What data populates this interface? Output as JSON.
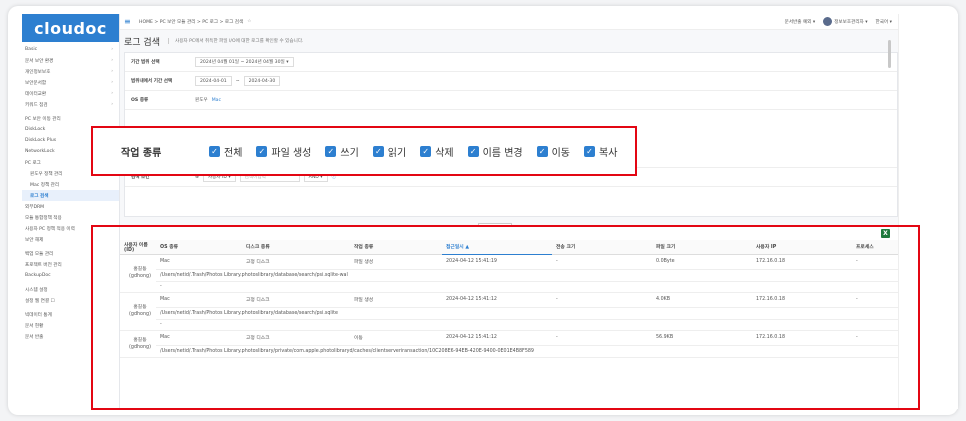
{
  "app": {
    "logo": "cloudoc"
  },
  "sidebar": {
    "items": [
      {
        "label": "Basic",
        "chev": "›"
      },
      {
        "label": "문서 보안 환경",
        "chev": "›"
      },
      {
        "label": "개인정보보호",
        "chev": "›"
      },
      {
        "label": "보안문서함",
        "chev": "›"
      },
      {
        "label": "데이터교환",
        "chev": "›"
      },
      {
        "label": "키워드 점검",
        "chev": "›"
      }
    ],
    "pc_section": "PC 보안 이동 관리",
    "pc_items": [
      "DiskLock",
      "DiskLock Plus",
      "NetworkLock",
      "PC 로그"
    ],
    "pc_log_sub": [
      "윈도우 정책 관리",
      "Mac 정책 관리",
      "로그 검색"
    ],
    "more_items": [
      "외부DRM",
      "모듈 통합정책 적용",
      "사용자 PC 정책 적용 이력",
      "보안 해제"
    ],
    "backup_items": [
      "백업 모듈 관리",
      "프로젝트 버전 관리",
      "BackupDoc"
    ],
    "system_items": [
      "시스템 설정",
      "설정 웹 연결 ☐"
    ],
    "stats_items": [
      "빅데이터 통계",
      "문서 현황",
      "문서 반출"
    ]
  },
  "topbar": {
    "breadcrumb": "HOME > PC 보안 모듈 관리 > PC 로그 > 로그 검색",
    "star": "☆",
    "notify": "문서반출 예외 ▾",
    "user": "정보보호관리자 ▾",
    "lang": "한국어 ▾"
  },
  "page": {
    "title": "로그 검색",
    "description": "사용자 PC에서 취득한 파일 I/O에 대한 로그를 확인할 수 있습니다."
  },
  "form": {
    "period_label": "기간 범위 선택",
    "period_value": "2024년 04월 01일 ~ 2024년 04월 30일 ▾",
    "range_label": "범위내에서 기간 선택",
    "date_from": "2024-04-01",
    "date_to": "2024-04-30",
    "os_label": "OS 종류",
    "os_option1": "윈도우",
    "os_option2": "Mac",
    "cond_label": "검색 조건",
    "cond_plus": "⊕",
    "cond_field": "사용자 ID ▾",
    "cond_placeholder": "검색어입력",
    "cond_op": "AND ▾",
    "cond_info": "ⓘ",
    "search_button": "검색"
  },
  "highlight": {
    "title": "작업 종류",
    "options": [
      "전체",
      "파일 생성",
      "쓰기",
      "읽기",
      "삭제",
      "이름 변경",
      "이동",
      "복사"
    ]
  },
  "table": {
    "excel_icon": "X",
    "columns": [
      "사용자 이름(ID)",
      "OS 종류",
      "디스크 종류",
      "작업 종류",
      "접근일시 ▲",
      "전송 크기",
      "파일 크기",
      "사용자 IP",
      "프로세스"
    ],
    "rows": [
      {
        "user": "홍길동 (gdhong)",
        "os": "Mac",
        "disk": "고정 디스크",
        "action": "파일 생성",
        "date": "2024-04-12 15:41:19",
        "transfer": "-",
        "size": "0.0Byte",
        "ip": "172.16.0.18",
        "process": "-",
        "path": "/Users/netid/.Trash/Photos Library.photoslibrary/database/search/psi.sqlite-wal",
        "dash": "-"
      },
      {
        "user": "홍길동 (gdhong)",
        "os": "Mac",
        "disk": "고정 디스크",
        "action": "파일 생성",
        "date": "2024-04-12 15:41:12",
        "transfer": "-",
        "size": "4.0KB",
        "ip": "172.16.0.18",
        "process": "-",
        "path": "/Users/netid/.Trash/Photos Library.photoslibrary/database/search/psi.sqlite",
        "dash": "-"
      },
      {
        "user": "홍길동 (gdhong)",
        "os": "Mac",
        "disk": "고정 디스크",
        "action": "이동",
        "date": "2024-04-12 15:41:12",
        "transfer": "-",
        "size": "56.9KB",
        "ip": "172.16.0.18",
        "process": "-",
        "path": "/Users/netid/.Trash/Photos Library.photoslibrary/private/com.apple.photolibraryd/caches/clientserveriransaction/10C208E6-94EB-420E-9400-0E01E4B8F589",
        "dash": ""
      }
    ]
  }
}
